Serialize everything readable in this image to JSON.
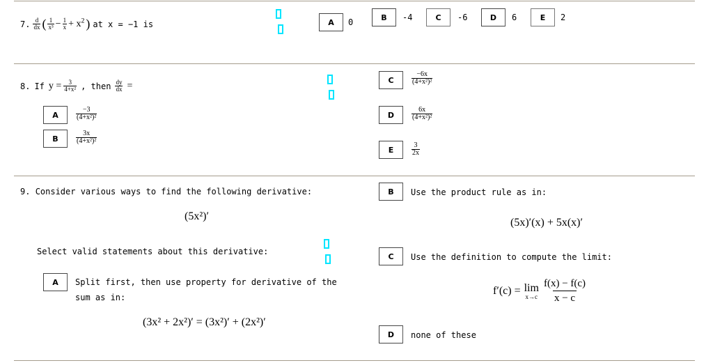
{
  "q7": {
    "number": "7.",
    "prefix_deriv": {
      "num": "d",
      "den": "dx"
    },
    "term1": {
      "num": "1",
      "den": "x³"
    },
    "minus": "−",
    "term2": {
      "num": "1",
      "den": "x"
    },
    "plus_x2": "+ x",
    "sup2": "2",
    "open_paren": "(",
    "close_paren": ")",
    "tail": "at x = −1 is",
    "options": [
      {
        "letter": "A",
        "text": "0"
      },
      {
        "letter": "B",
        "text": "-4"
      },
      {
        "letter": "C",
        "text": "-6"
      },
      {
        "letter": "D",
        "text": "6"
      },
      {
        "letter": "E",
        "text": "2"
      }
    ]
  },
  "q8": {
    "number": "8.",
    "if": "If",
    "y_eq": "y =",
    "y_frac": {
      "num": "3",
      "den": "4+x²"
    },
    "then": ", then",
    "dydx": {
      "num": "dy",
      "den": "dx"
    },
    "eq": "=",
    "options": [
      {
        "letter": "A",
        "num": "−3",
        "den": "(4+x²)²"
      },
      {
        "letter": "B",
        "num": "3x",
        "den": "(4+x²)²"
      },
      {
        "letter": "C",
        "num": "−6x",
        "den": "(4+x²)²"
      },
      {
        "letter": "D",
        "num": "6x",
        "den": "(4+x²)²"
      },
      {
        "letter": "E",
        "num": "3",
        "den": "2x"
      }
    ]
  },
  "q9": {
    "number": "9.",
    "prompt": "Consider various ways to find the following derivative:",
    "expression": "(5x²)′",
    "select_prompt": "Select valid statements about this derivative:",
    "options": [
      {
        "letter": "A",
        "text_line1": "Split first, then use property for derivative of the",
        "text_line2": "sum as in:",
        "formula": "(3x² + 2x²)′ = (3x²)′ + (2x²)′"
      },
      {
        "letter": "B",
        "text_line1": "Use the product rule as in:",
        "formula": "(5x)′(x) + 5x(x)′"
      },
      {
        "letter": "C",
        "text_line1": "Use the definition to compute the limit:",
        "formula_lhs": "f′(c) =",
        "lim": "lim",
        "lim_sub": "x→c",
        "frac_num": "f(x) − f(c)",
        "frac_den": "x − c"
      },
      {
        "letter": "D",
        "text_line1": "none of these"
      }
    ]
  },
  "colors": {
    "rule": "#a59c8c",
    "marker": "#00e5ff"
  }
}
